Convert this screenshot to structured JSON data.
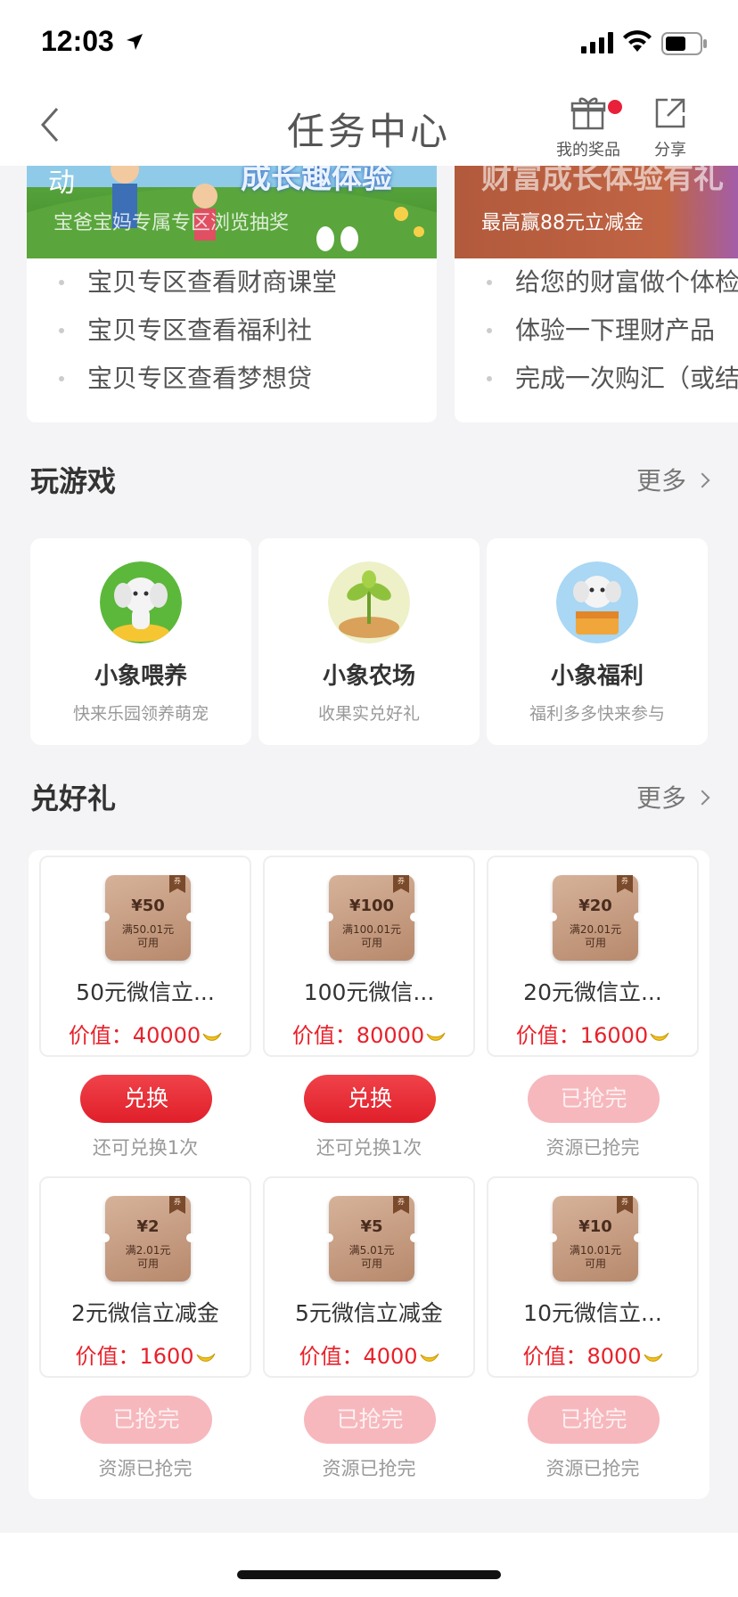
{
  "status_bar": {
    "time": "12:03"
  },
  "nav": {
    "title": "任务中心",
    "prize_label": "我的奖品",
    "share_label": "分享"
  },
  "activities": [
    {
      "banner_edge": "动",
      "banner_title": "成长趣体验",
      "banner_sub": "宝爸宝妈专属专区浏览抽奖",
      "tasks": [
        "宝贝专区查看财商课堂",
        "宝贝专区查看福利社",
        "宝贝专区查看梦想贷"
      ]
    },
    {
      "banner_title": "财富成长体验有礼",
      "banner_sub": "最高赢88元立减金",
      "tasks": [
        "给您的财富做个体检",
        "体验一下理财产品",
        "完成一次购汇（或结"
      ]
    }
  ],
  "games_section": {
    "title": "玩游戏",
    "more": "更多",
    "items": [
      {
        "name": "小象喂养",
        "desc": "快来乐园领养萌宠",
        "icon": "elephant-feeding-icon"
      },
      {
        "name": "小象农场",
        "desc": "收果实兑好礼",
        "icon": "bean-sprout-icon"
      },
      {
        "name": "小象福利",
        "desc": "福利多多快来参与",
        "icon": "elephant-treasure-icon"
      }
    ]
  },
  "gifts_section": {
    "title": "兑好礼",
    "more": "更多",
    "tag": "券",
    "items": [
      {
        "amount": "¥50",
        "cond1": "满50.01元",
        "cond2": "可用",
        "name": "50元微信立...",
        "price": "价值：40000",
        "button": "兑换",
        "note": "还可兑换1次",
        "state": "active"
      },
      {
        "amount": "¥100",
        "cond1": "满100.01元",
        "cond2": "可用",
        "name": "100元微信...",
        "price": "价值：80000",
        "button": "兑换",
        "note": "还可兑换1次",
        "state": "active"
      },
      {
        "amount": "¥20",
        "cond1": "满20.01元",
        "cond2": "可用",
        "name": "20元微信立...",
        "price": "价值：16000",
        "button": "已抢完",
        "note": "资源已抢完",
        "state": "done"
      },
      {
        "amount": "¥2",
        "cond1": "满2.01元",
        "cond2": "可用",
        "name": "2元微信立减金",
        "price": "价值：1600",
        "button": "已抢完",
        "note": "资源已抢完",
        "state": "done"
      },
      {
        "amount": "¥5",
        "cond1": "满5.01元",
        "cond2": "可用",
        "name": "5元微信立减金",
        "price": "价值：4000",
        "button": "已抢完",
        "note": "资源已抢完",
        "state": "done"
      },
      {
        "amount": "¥10",
        "cond1": "满10.01元",
        "cond2": "可用",
        "name": "10元微信立...",
        "price": "价值：8000",
        "button": "已抢完",
        "note": "资源已抢完",
        "state": "done"
      }
    ]
  },
  "colors": {
    "accent_red": "#e8212a",
    "disabled_pink": "#f6b8bd",
    "coupon_brown": "#b7896c"
  }
}
